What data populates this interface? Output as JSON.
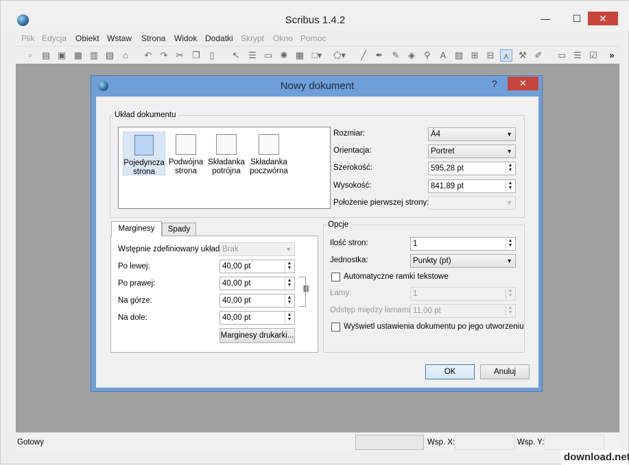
{
  "app": {
    "title": "Scribus 1.4.2"
  },
  "window_controls": {
    "minimize": "—",
    "maximize": "☐",
    "close": "✕"
  },
  "menu": [
    "Plik",
    "Edycja",
    "Obiekt",
    "Wstaw",
    "Strona",
    "Widok",
    "Dodatki",
    "Skrypt",
    "Okno",
    "Pomoc"
  ],
  "toolbar": {
    "more": "»"
  },
  "status": {
    "text": "Gotowy",
    "x_label": "Wsp. X:",
    "y_label": "Wsp. Y:"
  },
  "dialog": {
    "title": "Nowy dokument",
    "help": "?",
    "close": "✕",
    "layout_group": "Układ dokumentu",
    "layouts": [
      {
        "line1": "Pojedyncza",
        "line2": "strona"
      },
      {
        "line1": "Podwójna",
        "line2": "strona"
      },
      {
        "line1": "Składanka",
        "line2": "potrójna"
      },
      {
        "line1": "Składanka",
        "line2": "poczwórna"
      }
    ],
    "size_label": "Rozmiar:",
    "size_value": "A4",
    "orientation_label": "Orientacja:",
    "orientation_value": "Portret",
    "width_label": "Szerokość:",
    "width_value": "595,28 pt",
    "height_label": "Wysokość:",
    "height_value": "841,89 pt",
    "first_page_label": "Położenie pierwszej strony:",
    "tabs": [
      "Marginesy",
      "Spady"
    ],
    "preset_label": "Wstępnie zdefiniowany układ:",
    "preset_value": "Brak",
    "left_label": "Po lewej:",
    "left_value": "40,00 pt",
    "right_label": "Po prawej:",
    "right_value": "40,00 pt",
    "top_label": "Na górze:",
    "top_value": "40,00 pt",
    "bottom_label": "Na dole:",
    "bottom_value": "40,00 pt",
    "printer_margins": "Marginesy drukarki...",
    "options_group": "Opcje",
    "pages_label": "Ilość stron:",
    "pages_value": "1",
    "unit_label": "Jednostka:",
    "unit_value": "Punkty (pt)",
    "auto_frames": "Automatyczne ramki tekstowe",
    "columns_label": "Łamy:",
    "columns_value": "1",
    "gap_label": "Odstęp między łamami:",
    "gap_value": "11,00 pt",
    "show_settings": "Wyświetl ustawienia dokumentu po jego utworzeniu",
    "ok": "OK",
    "cancel": "Anuluj"
  },
  "watermark": "download.net.pl"
}
